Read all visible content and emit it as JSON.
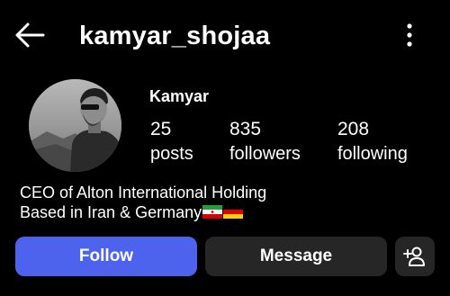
{
  "header": {
    "username": "kamyar_shojaa",
    "back_icon": "arrow-left-icon",
    "more_icon": "more-vertical-icon"
  },
  "profile": {
    "display_name": "Kamyar",
    "avatar": "avatar-photo",
    "stats": [
      {
        "value": "25",
        "label": "posts"
      },
      {
        "value": "835",
        "label": "followers"
      },
      {
        "value": "208",
        "label": "following"
      }
    ],
    "bio_line1": "CEO of Alton International Holding",
    "bio_line2": "Based in Iran & Germany"
  },
  "actions": {
    "follow_label": "Follow",
    "message_label": "Message",
    "suggest_icon": "add-person-icon"
  },
  "colors": {
    "background": "#000000",
    "follow_button": "#4d63ee",
    "secondary_button": "#262626",
    "text": "#ffffff"
  }
}
